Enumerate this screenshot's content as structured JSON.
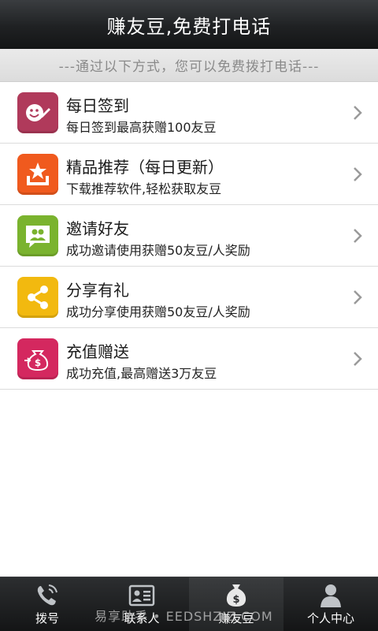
{
  "header": {
    "title": "赚友豆,免费打电话"
  },
  "subheader": {
    "text": "---通过以下方式，您可以免费拨打电话---"
  },
  "items": [
    {
      "title": "每日签到",
      "subtitle": "每日签到最高获赠100友豆",
      "icon": "checkin-icon",
      "color": "#b03a5b"
    },
    {
      "title": "精品推荐（每日更新）",
      "subtitle": "下载推荐软件,轻松获取友豆",
      "icon": "star-tray-icon",
      "color": "#f05a1e"
    },
    {
      "title": "邀请好友",
      "subtitle": "成功邀请使用获赠50友豆/人奖励",
      "icon": "invite-friends-icon",
      "color": "#7ab32e"
    },
    {
      "title": "分享有礼",
      "subtitle": "成功分享使用获赠50友豆/人奖励",
      "icon": "share-icon",
      "color": "#f2b90f"
    },
    {
      "title": "充值赠送",
      "subtitle": "成功充值,最高赠送3万友豆",
      "icon": "recharge-icon",
      "color": "#d4285f"
    }
  ],
  "tabs": [
    {
      "label": "拨号",
      "icon": "phone-icon",
      "active": false
    },
    {
      "label": "联系人",
      "icon": "contacts-icon",
      "active": false
    },
    {
      "label": "赚友豆",
      "icon": "money-bag-icon",
      "active": true
    },
    {
      "label": "个人中心",
      "icon": "person-icon",
      "active": false
    }
  ],
  "watermark": "易享助手 • EEDSHZIZ.COM"
}
